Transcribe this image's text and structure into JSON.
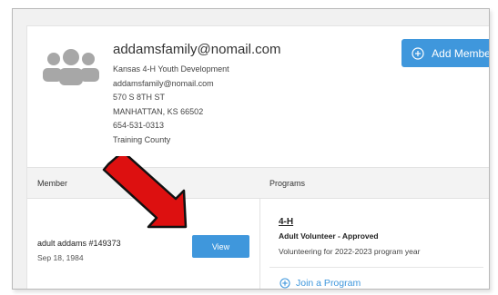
{
  "family": {
    "email": "addamsfamily@nomail.com",
    "details": [
      "Kansas 4-H Youth Development",
      "addamsfamily@nomail.com",
      "570 S 8TH ST",
      "MANHATTAN, KS 66502",
      "654-531-0313",
      "Training County"
    ]
  },
  "actions": {
    "add_member_label": "Add Member"
  },
  "table": {
    "headers": {
      "member": "Member",
      "programs": "Programs"
    },
    "rows": [
      {
        "member_name": "adult addams #149373",
        "member_dob": "Sep 18, 1984",
        "view_label": "View",
        "program": {
          "title": "4-H",
          "role": "Adult Volunteer - Approved",
          "note": "Volunteering for 2022-2023 program year"
        },
        "join_label": "Join a Program"
      }
    ]
  },
  "colors": {
    "accent": "#3f97dc",
    "annotation_arrow": "#dd1010",
    "avatar_gray": "#a7a7a7"
  },
  "icons": {
    "avatar": "family-avatar-icon",
    "add_member": "plus-circle-icon",
    "join": "plus-circle-icon",
    "annotation": "red-arrow-icon"
  }
}
